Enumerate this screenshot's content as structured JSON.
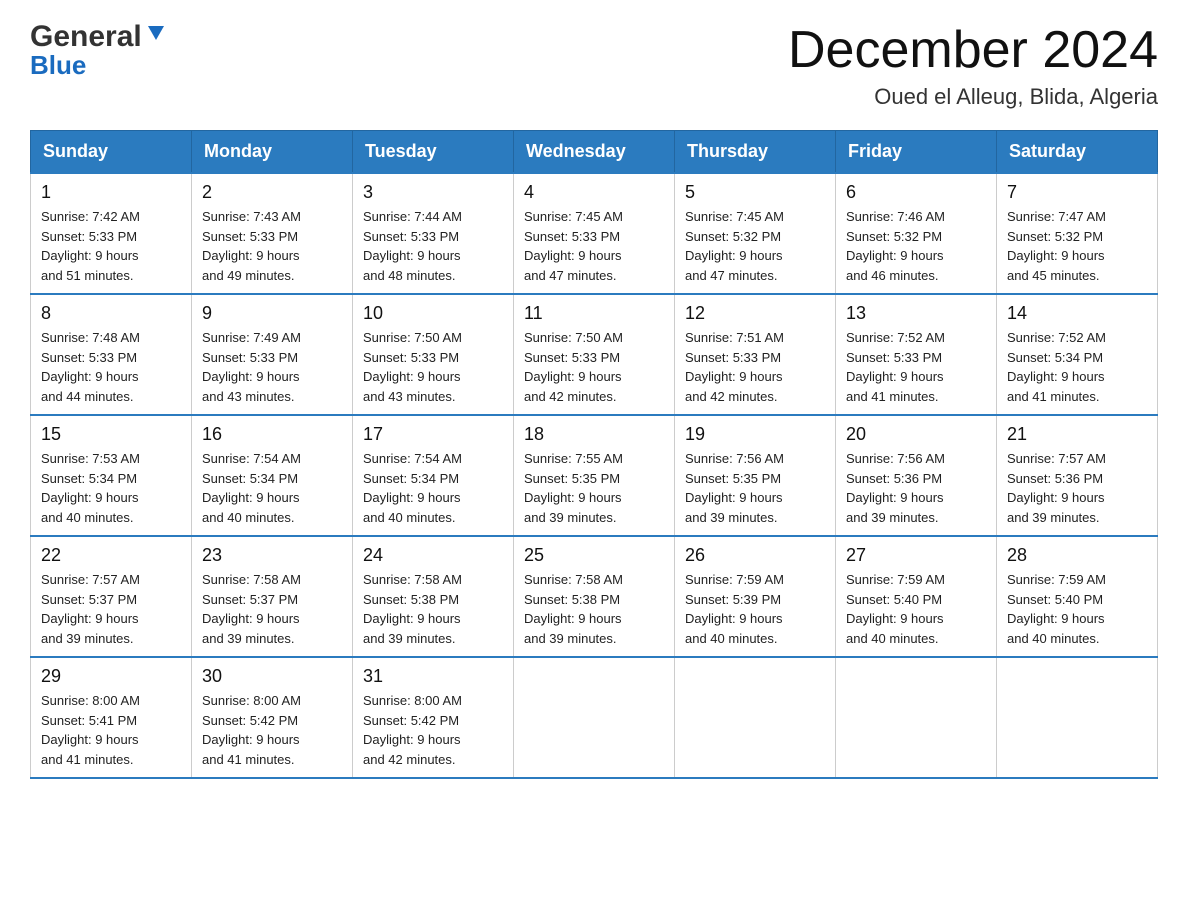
{
  "logo": {
    "general": "General",
    "blue": "Blue"
  },
  "header": {
    "month": "December 2024",
    "location": "Oued el Alleug, Blida, Algeria"
  },
  "days_header": [
    "Sunday",
    "Monday",
    "Tuesday",
    "Wednesday",
    "Thursday",
    "Friday",
    "Saturday"
  ],
  "weeks": [
    [
      {
        "date": "1",
        "sunrise": "7:42 AM",
        "sunset": "5:33 PM",
        "daylight": "9 hours and 51 minutes."
      },
      {
        "date": "2",
        "sunrise": "7:43 AM",
        "sunset": "5:33 PM",
        "daylight": "9 hours and 49 minutes."
      },
      {
        "date": "3",
        "sunrise": "7:44 AM",
        "sunset": "5:33 PM",
        "daylight": "9 hours and 48 minutes."
      },
      {
        "date": "4",
        "sunrise": "7:45 AM",
        "sunset": "5:33 PM",
        "daylight": "9 hours and 47 minutes."
      },
      {
        "date": "5",
        "sunrise": "7:45 AM",
        "sunset": "5:32 PM",
        "daylight": "9 hours and 47 minutes."
      },
      {
        "date": "6",
        "sunrise": "7:46 AM",
        "sunset": "5:32 PM",
        "daylight": "9 hours and 46 minutes."
      },
      {
        "date": "7",
        "sunrise": "7:47 AM",
        "sunset": "5:32 PM",
        "daylight": "9 hours and 45 minutes."
      }
    ],
    [
      {
        "date": "8",
        "sunrise": "7:48 AM",
        "sunset": "5:33 PM",
        "daylight": "9 hours and 44 minutes."
      },
      {
        "date": "9",
        "sunrise": "7:49 AM",
        "sunset": "5:33 PM",
        "daylight": "9 hours and 43 minutes."
      },
      {
        "date": "10",
        "sunrise": "7:50 AM",
        "sunset": "5:33 PM",
        "daylight": "9 hours and 43 minutes."
      },
      {
        "date": "11",
        "sunrise": "7:50 AM",
        "sunset": "5:33 PM",
        "daylight": "9 hours and 42 minutes."
      },
      {
        "date": "12",
        "sunrise": "7:51 AM",
        "sunset": "5:33 PM",
        "daylight": "9 hours and 42 minutes."
      },
      {
        "date": "13",
        "sunrise": "7:52 AM",
        "sunset": "5:33 PM",
        "daylight": "9 hours and 41 minutes."
      },
      {
        "date": "14",
        "sunrise": "7:52 AM",
        "sunset": "5:34 PM",
        "daylight": "9 hours and 41 minutes."
      }
    ],
    [
      {
        "date": "15",
        "sunrise": "7:53 AM",
        "sunset": "5:34 PM",
        "daylight": "9 hours and 40 minutes."
      },
      {
        "date": "16",
        "sunrise": "7:54 AM",
        "sunset": "5:34 PM",
        "daylight": "9 hours and 40 minutes."
      },
      {
        "date": "17",
        "sunrise": "7:54 AM",
        "sunset": "5:34 PM",
        "daylight": "9 hours and 40 minutes."
      },
      {
        "date": "18",
        "sunrise": "7:55 AM",
        "sunset": "5:35 PM",
        "daylight": "9 hours and 39 minutes."
      },
      {
        "date": "19",
        "sunrise": "7:56 AM",
        "sunset": "5:35 PM",
        "daylight": "9 hours and 39 minutes."
      },
      {
        "date": "20",
        "sunrise": "7:56 AM",
        "sunset": "5:36 PM",
        "daylight": "9 hours and 39 minutes."
      },
      {
        "date": "21",
        "sunrise": "7:57 AM",
        "sunset": "5:36 PM",
        "daylight": "9 hours and 39 minutes."
      }
    ],
    [
      {
        "date": "22",
        "sunrise": "7:57 AM",
        "sunset": "5:37 PM",
        "daylight": "9 hours and 39 minutes."
      },
      {
        "date": "23",
        "sunrise": "7:58 AM",
        "sunset": "5:37 PM",
        "daylight": "9 hours and 39 minutes."
      },
      {
        "date": "24",
        "sunrise": "7:58 AM",
        "sunset": "5:38 PM",
        "daylight": "9 hours and 39 minutes."
      },
      {
        "date": "25",
        "sunrise": "7:58 AM",
        "sunset": "5:38 PM",
        "daylight": "9 hours and 39 minutes."
      },
      {
        "date": "26",
        "sunrise": "7:59 AM",
        "sunset": "5:39 PM",
        "daylight": "9 hours and 40 minutes."
      },
      {
        "date": "27",
        "sunrise": "7:59 AM",
        "sunset": "5:40 PM",
        "daylight": "9 hours and 40 minutes."
      },
      {
        "date": "28",
        "sunrise": "7:59 AM",
        "sunset": "5:40 PM",
        "daylight": "9 hours and 40 minutes."
      }
    ],
    [
      {
        "date": "29",
        "sunrise": "8:00 AM",
        "sunset": "5:41 PM",
        "daylight": "9 hours and 41 minutes."
      },
      {
        "date": "30",
        "sunrise": "8:00 AM",
        "sunset": "5:42 PM",
        "daylight": "9 hours and 41 minutes."
      },
      {
        "date": "31",
        "sunrise": "8:00 AM",
        "sunset": "5:42 PM",
        "daylight": "9 hours and 42 minutes."
      },
      null,
      null,
      null,
      null
    ]
  ],
  "labels": {
    "sunrise": "Sunrise: ",
    "sunset": "Sunset: ",
    "daylight": "Daylight: "
  }
}
